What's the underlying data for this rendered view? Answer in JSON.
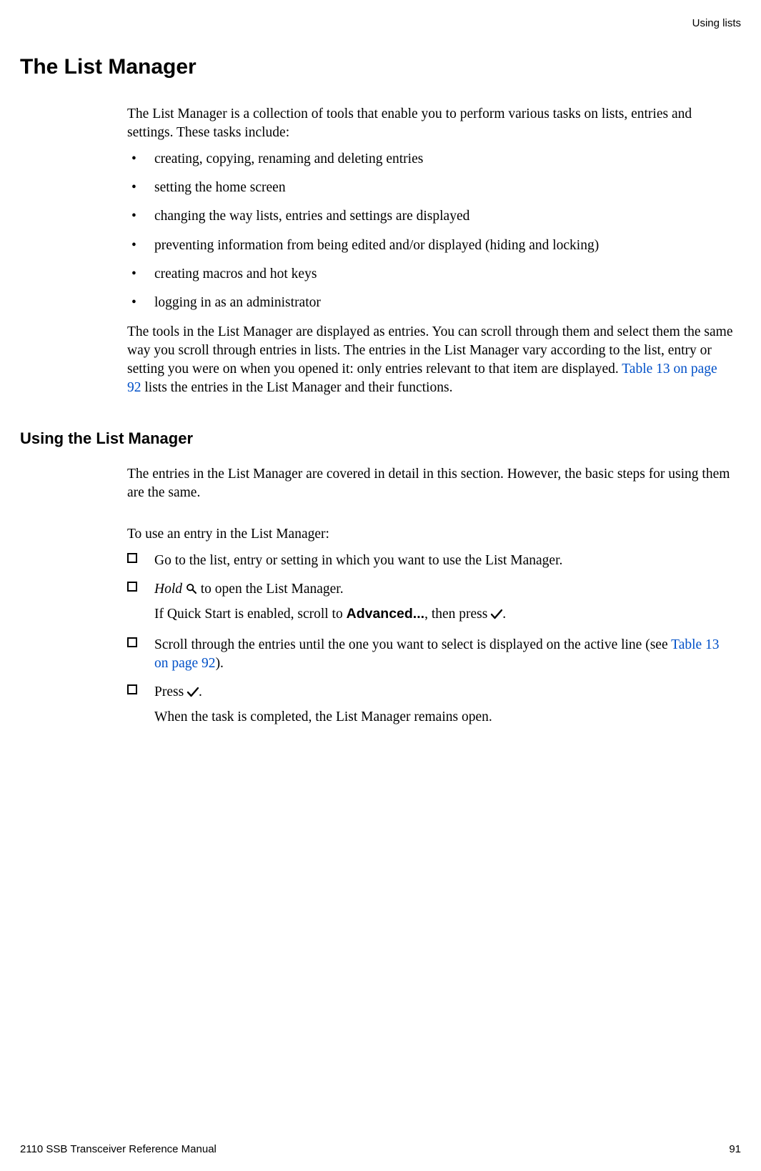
{
  "header": {
    "running_head": "Using lists"
  },
  "section": {
    "title": "The List Manager",
    "intro": "The List Manager is a collection of tools that enable you to perform various tasks on lists, entries and settings. These tasks include:",
    "bullets": [
      "creating, copying, renaming and deleting entries",
      "setting the home screen",
      "changing the way lists, entries and settings are displayed",
      "preventing information from being edited and/or displayed (hiding and locking)",
      "creating macros and hot keys",
      "logging in as an administrator"
    ],
    "para2_part1": "The tools in the List Manager are displayed as entries. You can scroll through them and select them the same way you scroll through entries in lists. The entries in the List Manager vary according to the list, entry or setting you were on when you opened it: only entries relevant to that item are displayed. ",
    "para2_link": "Table 13 on page 92",
    "para2_part2": " lists the entries in the List Manager and their functions."
  },
  "subsection": {
    "title": "Using the List Manager",
    "intro": "The entries in the List Manager are covered in detail in this section. However, the basic steps for using them are the same.",
    "lead": "To use an entry in the List Manager:",
    "steps": {
      "s1": "Go to the list, entry or setting in which you want to use the List Manager.",
      "s2_hold": "Hold",
      "s2_rest": " to open the List Manager.",
      "s2_note_pre": "If Quick Start is enabled, scroll to ",
      "s2_note_bold": "Advanced...",
      "s2_note_mid": ", then press ",
      "s2_note_post": ".",
      "s3_pre": "Scroll through the entries until the one you want to select is displayed on the active line (see ",
      "s3_link": "Table 13 on page 92",
      "s3_post": ").",
      "s4_pre": "Press ",
      "s4_post": ".",
      "s4_note": "When the task is completed, the List Manager remains open."
    }
  },
  "footer": {
    "manual": "2110 SSB Transceiver Reference Manual",
    "page": "91"
  }
}
